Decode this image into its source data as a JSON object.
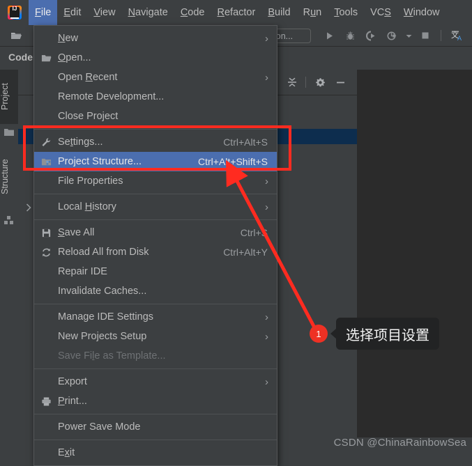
{
  "app": {
    "logo_icon": "intellij-idea-logo",
    "breadcrumb": "Code"
  },
  "menubar": {
    "items": [
      {
        "label": "File",
        "mnemonic": "F",
        "active": true
      },
      {
        "label": "Edit",
        "mnemonic": "E",
        "active": false
      },
      {
        "label": "View",
        "mnemonic": "V",
        "active": false
      },
      {
        "label": "Navigate",
        "mnemonic": "N",
        "active": false
      },
      {
        "label": "Code",
        "mnemonic": "C",
        "active": false
      },
      {
        "label": "Refactor",
        "mnemonic": "R",
        "active": false
      },
      {
        "label": "Build",
        "mnemonic": "B",
        "active": false
      },
      {
        "label": "Run",
        "mnemonic": "u",
        "active": false
      },
      {
        "label": "Tools",
        "mnemonic": "T",
        "active": false
      },
      {
        "label": "VCS",
        "mnemonic": "S",
        "active": false
      },
      {
        "label": "Window",
        "mnemonic": "W",
        "active": false
      }
    ]
  },
  "toolbar": {
    "open_icon": "folder-open-icon",
    "run_config_value": "ion...",
    "right_icons": [
      {
        "name": "run-icon"
      },
      {
        "name": "debug-icon"
      },
      {
        "name": "run-with-coverage-icon"
      },
      {
        "name": "profiler-icon"
      },
      {
        "name": "dropdown-chevron-icon"
      },
      {
        "name": "stop-icon"
      },
      {
        "name": "translate-icon"
      }
    ]
  },
  "sidebar": {
    "tabs": [
      {
        "label": "Project",
        "selected": true
      },
      {
        "label": "Structure",
        "selected": false
      }
    ],
    "project_icon": "folder-icon",
    "structure_icon": "structure-blocks-icon",
    "expand_icon": "chevron-right-icon"
  },
  "tool_window": {
    "header_icons": [
      {
        "name": "collapse-all-icon"
      },
      {
        "name": "settings-gear-icon"
      },
      {
        "name": "hide-window-icon"
      }
    ],
    "collapse_chevron_icon": "chevron-down-icon"
  },
  "file_menu": {
    "items": [
      {
        "type": "item",
        "label": "New",
        "mnemonic": "N",
        "icon": "",
        "shortcut": "",
        "submenu": true,
        "highlighted": false,
        "disabled": false
      },
      {
        "type": "item",
        "label": "Open...",
        "mnemonic": "O",
        "icon": "folder-open-icon",
        "shortcut": "",
        "submenu": false,
        "highlighted": false,
        "disabled": false
      },
      {
        "type": "item",
        "label": "Open Recent",
        "mnemonic": "R",
        "icon": "",
        "shortcut": "",
        "submenu": true,
        "highlighted": false,
        "disabled": false
      },
      {
        "type": "item",
        "label": "Remote Development...",
        "mnemonic": "",
        "icon": "",
        "shortcut": "",
        "submenu": false,
        "highlighted": false,
        "disabled": false
      },
      {
        "type": "item",
        "label": "Close Project",
        "mnemonic": "",
        "icon": "",
        "shortcut": "",
        "submenu": false,
        "highlighted": false,
        "disabled": false
      },
      {
        "type": "separator"
      },
      {
        "type": "item",
        "label": "Settings...",
        "mnemonic": "t",
        "icon": "wrench-icon",
        "shortcut": "Ctrl+Alt+S",
        "submenu": false,
        "highlighted": false,
        "disabled": false
      },
      {
        "type": "item",
        "label": "Project Structure...",
        "mnemonic": "",
        "icon": "project-structure-icon",
        "shortcut": "Ctrl+Alt+Shift+S",
        "submenu": false,
        "highlighted": true,
        "disabled": false
      },
      {
        "type": "item",
        "label": "File Properties",
        "mnemonic": "",
        "icon": "",
        "shortcut": "",
        "submenu": true,
        "highlighted": false,
        "disabled": false
      },
      {
        "type": "separator"
      },
      {
        "type": "item",
        "label": "Local History",
        "mnemonic": "H",
        "icon": "",
        "shortcut": "",
        "submenu": true,
        "highlighted": false,
        "disabled": false
      },
      {
        "type": "separator"
      },
      {
        "type": "item",
        "label": "Save All",
        "mnemonic": "S",
        "icon": "save-icon",
        "shortcut": "Ctrl+S",
        "submenu": false,
        "highlighted": false,
        "disabled": false
      },
      {
        "type": "item",
        "label": "Reload All from Disk",
        "mnemonic": "",
        "icon": "reload-icon",
        "shortcut": "Ctrl+Alt+Y",
        "submenu": false,
        "highlighted": false,
        "disabled": false
      },
      {
        "type": "item",
        "label": "Repair IDE",
        "mnemonic": "",
        "icon": "",
        "shortcut": "",
        "submenu": false,
        "highlighted": false,
        "disabled": false
      },
      {
        "type": "item",
        "label": "Invalidate Caches...",
        "mnemonic": "",
        "icon": "",
        "shortcut": "",
        "submenu": false,
        "highlighted": false,
        "disabled": false
      },
      {
        "type": "separator"
      },
      {
        "type": "item",
        "label": "Manage IDE Settings",
        "mnemonic": "",
        "icon": "",
        "shortcut": "",
        "submenu": true,
        "highlighted": false,
        "disabled": false
      },
      {
        "type": "item",
        "label": "New Projects Setup",
        "mnemonic": "",
        "icon": "",
        "shortcut": "",
        "submenu": true,
        "highlighted": false,
        "disabled": false
      },
      {
        "type": "item",
        "label": "Save File as Template...",
        "mnemonic": "l",
        "icon": "",
        "shortcut": "",
        "submenu": false,
        "highlighted": false,
        "disabled": true
      },
      {
        "type": "separator"
      },
      {
        "type": "item",
        "label": "Export",
        "mnemonic": "",
        "icon": "",
        "shortcut": "",
        "submenu": true,
        "highlighted": false,
        "disabled": false
      },
      {
        "type": "item",
        "label": "Print...",
        "mnemonic": "P",
        "icon": "print-icon",
        "shortcut": "",
        "submenu": false,
        "highlighted": false,
        "disabled": false
      },
      {
        "type": "separator"
      },
      {
        "type": "item",
        "label": "Power Save Mode",
        "mnemonic": "",
        "icon": "",
        "shortcut": "",
        "submenu": false,
        "highlighted": false,
        "disabled": false
      },
      {
        "type": "separator"
      },
      {
        "type": "item",
        "label": "Exit",
        "mnemonic": "x",
        "icon": "",
        "shortcut": "",
        "submenu": false,
        "highlighted": false,
        "disabled": false
      }
    ]
  },
  "annotation": {
    "badge_number": "1",
    "callout_text": "选择项目设置",
    "highlight_color": "#FF2B20",
    "badge_color": "#EE3124",
    "callout_bg": "#222324"
  },
  "watermark": {
    "text": "CSDN @ChinaRainbowSea"
  },
  "colors": {
    "window_bg": "#3C3F41",
    "editor_bg": "#2B2B2B",
    "menu_bg": "#3C3F41",
    "selection_blue": "#4B6EAF",
    "tree_selection": "#0D2D4E",
    "text": "#BBBBBB",
    "text_disabled": "#6E7174"
  }
}
